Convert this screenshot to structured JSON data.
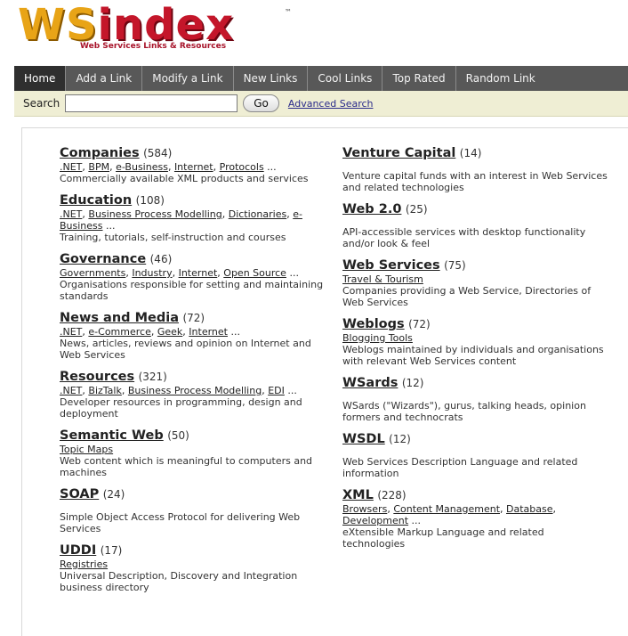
{
  "logo": {
    "word": "WSindex",
    "tm": "™",
    "tagline": "Web Services Links & Resources"
  },
  "nav": {
    "items": [
      "Home",
      "Add a Link",
      "Modify a Link",
      "New Links",
      "Cool Links",
      "Top Rated",
      "Random Link"
    ],
    "active": "Home"
  },
  "search": {
    "label": "Search",
    "value": "",
    "placeholder": "",
    "go_label": "Go",
    "advanced_label": "Advanced Search"
  },
  "categories_left": [
    {
      "title": "Companies",
      "count": "(584)",
      "subs": [
        ".NET",
        "BPM",
        "e-Business",
        "Internet",
        "Protocols"
      ],
      "more": "...",
      "desc": "Commercially available XML products and services"
    },
    {
      "title": "Education",
      "count": "(108)",
      "subs": [
        ".NET",
        "Business Process Modelling",
        "Dictionaries",
        "e-Business"
      ],
      "more": "...",
      "desc": "Training, tutorials, self-instruction and courses"
    },
    {
      "title": "Governance",
      "count": "(46)",
      "subs": [
        "Governments",
        "Industry",
        "Internet",
        "Open Source"
      ],
      "more": "...",
      "desc": "Organisations responsible for setting and maintaining standards"
    },
    {
      "title": "News and Media",
      "count": "(72)",
      "subs": [
        ".NET",
        "e-Commerce",
        "Geek",
        "Internet"
      ],
      "more": "...",
      "desc": "News, articles, reviews and opinion on Internet and Web Services"
    },
    {
      "title": "Resources",
      "count": "(321)",
      "subs": [
        ".NET",
        "BizTalk",
        "Business Process Modelling",
        "EDI"
      ],
      "more": "...",
      "desc": "Developer resources in programming, design and deployment"
    },
    {
      "title": "Semantic Web",
      "count": "(50)",
      "subs": [
        "Topic Maps"
      ],
      "more": "",
      "desc": "Web content which is meaningful to computers and machines"
    },
    {
      "title": "SOAP",
      "count": "(24)",
      "subs": [],
      "more": "",
      "desc": "Simple Object Access Protocol for delivering Web Services"
    },
    {
      "title": "UDDI",
      "count": "(17)",
      "subs": [
        "Registries"
      ],
      "more": "",
      "desc": "Universal Description, Discovery and Integration business directory"
    }
  ],
  "categories_right": [
    {
      "title": "Venture Capital",
      "count": "(14)",
      "subs": [],
      "more": "",
      "desc": "Venture capital funds with an interest in Web Services and related technologies"
    },
    {
      "title": "Web 2.0",
      "count": "(25)",
      "subs": [],
      "more": "",
      "desc": "API-accessible services with desktop functionality and/or look & feel"
    },
    {
      "title": "Web Services",
      "count": "(75)",
      "subs": [
        "Travel & Tourism"
      ],
      "more": "",
      "desc": "Companies providing a Web Service, Directories of Web Services"
    },
    {
      "title": "Weblogs",
      "count": "(72)",
      "subs": [
        "Blogging Tools"
      ],
      "more": "",
      "desc": "Weblogs maintained by individuals and organisations with relevant Web Services content"
    },
    {
      "title": "WSards",
      "count": "(12)",
      "subs": [],
      "more": "",
      "desc": "WSards (\"Wizards\"), gurus, talking heads, opinion formers and technocrats"
    },
    {
      "title": "WSDL",
      "count": "(12)",
      "subs": [],
      "more": "",
      "desc": "Web Services Description Language and related information"
    },
    {
      "title": "XML",
      "count": "(228)",
      "subs": [
        "Browsers",
        "Content Management",
        "Database",
        "Development"
      ],
      "more": "...",
      "desc": "eXtensible Markup Language and related technologies"
    }
  ]
}
